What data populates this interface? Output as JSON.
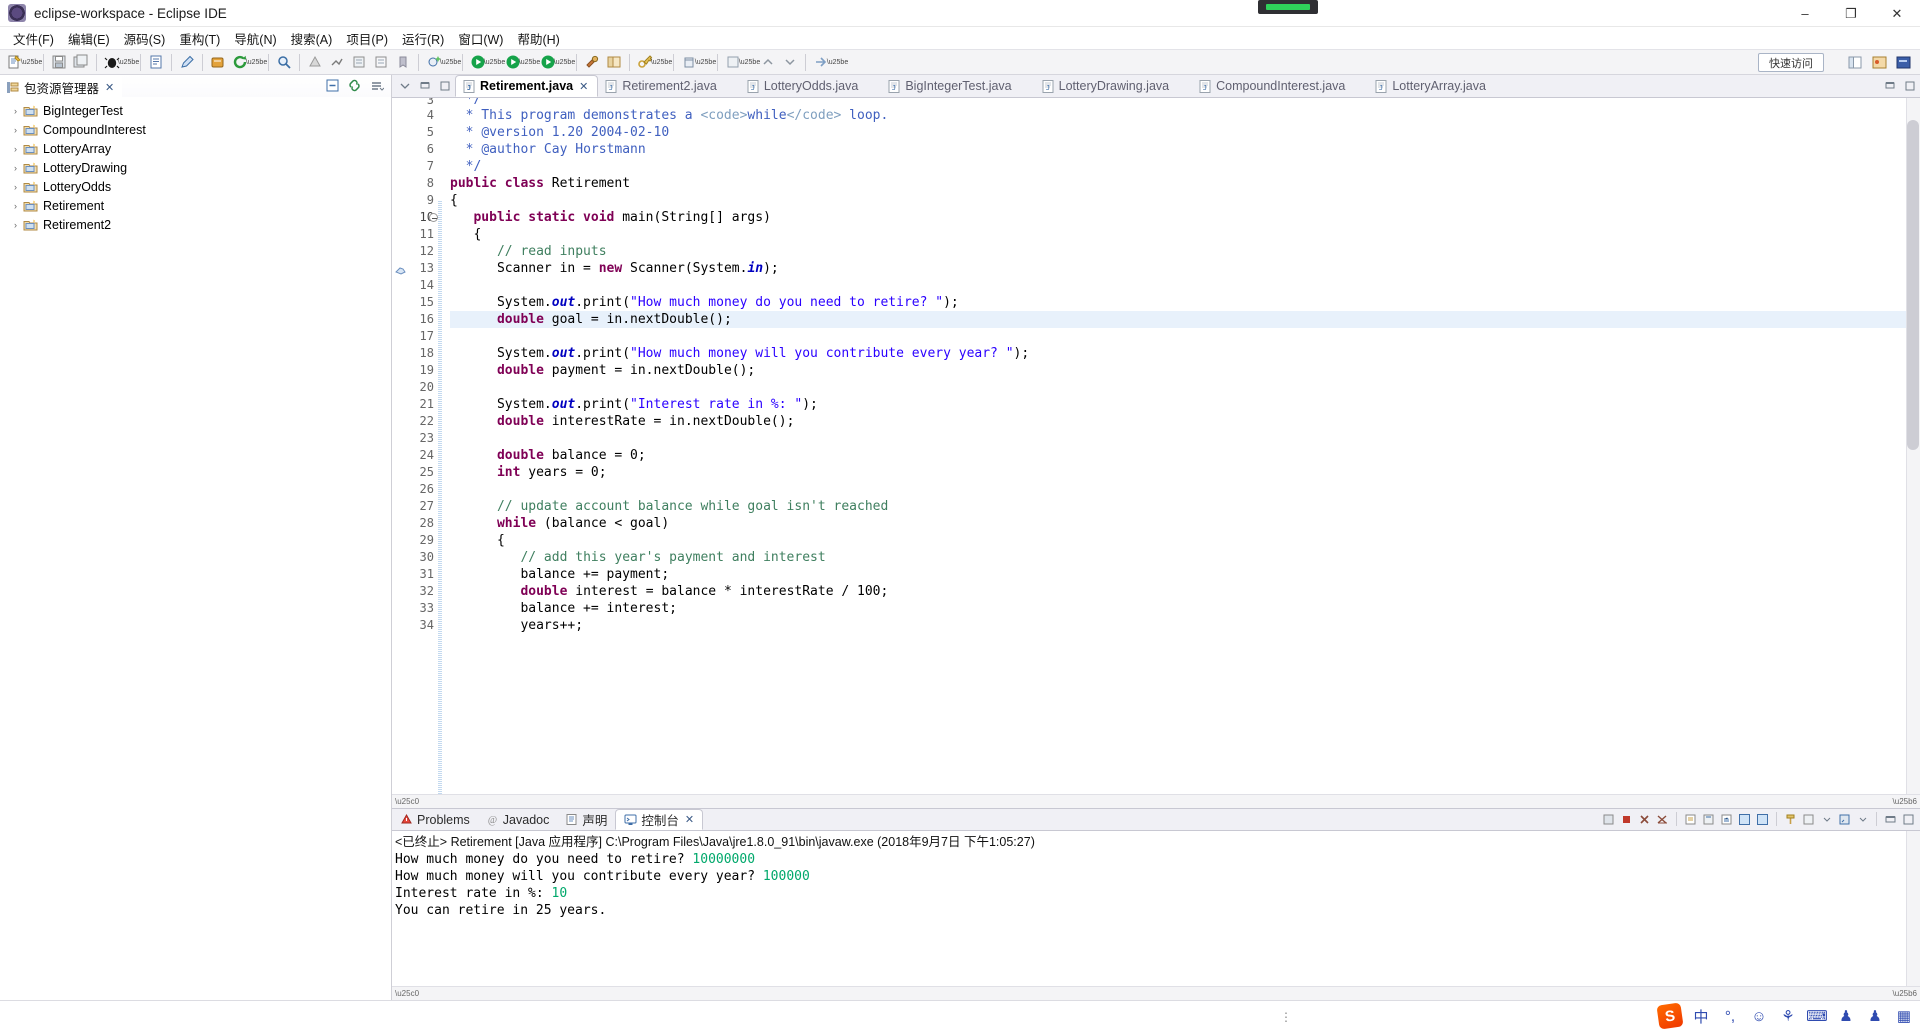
{
  "window": {
    "title": "eclipse-workspace - Eclipse IDE",
    "app_icon": "eclipse-icon",
    "minimize": "–",
    "maximize": "❐",
    "close": "✕"
  },
  "menubar": {
    "items": [
      {
        "label": "文件(F)",
        "name": "menu-file"
      },
      {
        "label": "编辑(E)",
        "name": "menu-edit"
      },
      {
        "label": "源码(S)",
        "name": "menu-source"
      },
      {
        "label": "重构(T)",
        "name": "menu-refactor"
      },
      {
        "label": "导航(N)",
        "name": "menu-navigate"
      },
      {
        "label": "搜索(A)",
        "name": "menu-search"
      },
      {
        "label": "项目(P)",
        "name": "menu-project"
      },
      {
        "label": "运行(R)",
        "name": "menu-run"
      },
      {
        "label": "窗口(W)",
        "name": "menu-window"
      },
      {
        "label": "帮助(H)",
        "name": "menu-help"
      }
    ]
  },
  "toolbar": {
    "quick_access": "快速访问",
    "quick_access_placeholder": "快速访问"
  },
  "sidebar": {
    "view_title": "包资源管理器",
    "close_glyph": "✕",
    "items": [
      {
        "label": "BigIntegerTest"
      },
      {
        "label": "CompoundInterest"
      },
      {
        "label": "LotteryArray"
      },
      {
        "label": "LotteryDrawing"
      },
      {
        "label": "LotteryOdds"
      },
      {
        "label": "Retirement"
      },
      {
        "label": "Retirement2"
      }
    ],
    "expander": "›"
  },
  "editor": {
    "tabs": [
      {
        "label": "Retirement.java",
        "active": true,
        "close": "✕"
      },
      {
        "label": "Retirement2.java",
        "active": false
      },
      {
        "label": "LotteryOdds.java",
        "active": false
      },
      {
        "label": "BigIntegerTest.java",
        "active": false
      },
      {
        "label": "LotteryDrawing.java",
        "active": false
      },
      {
        "label": "CompoundInterest.java",
        "active": false
      },
      {
        "label": "LotteryArray.java",
        "active": false
      }
    ],
    "first_visible_line": 4,
    "highlighted_line": 16,
    "breakpoint_line": 13,
    "fold_marker_line": 10,
    "lines": [
      {
        "n": 4,
        "segments": [
          {
            "t": "  * This program demonstrates a ",
            "c": "jdoc"
          },
          {
            "t": "<code>",
            "c": "jtag"
          },
          {
            "t": "while",
            "c": "jdoc"
          },
          {
            "t": "</code>",
            "c": "jtag"
          },
          {
            "t": " loop.",
            "c": "jdoc"
          }
        ]
      },
      {
        "n": 5,
        "segments": [
          {
            "t": "  * ",
            "c": "jdoc"
          },
          {
            "t": "@version",
            "c": "jdoc"
          },
          {
            "t": " 1.20 2004-02-10",
            "c": "jdoc"
          }
        ]
      },
      {
        "n": 6,
        "segments": [
          {
            "t": "  * ",
            "c": "jdoc"
          },
          {
            "t": "@author",
            "c": "jdoc"
          },
          {
            "t": " Cay Horstmann",
            "c": "jdoc"
          }
        ]
      },
      {
        "n": 7,
        "segments": [
          {
            "t": "  */",
            "c": "jdoc"
          }
        ]
      },
      {
        "n": 8,
        "segments": [
          {
            "t": "public class",
            "c": "kw"
          },
          {
            "t": " Retirement",
            "c": ""
          }
        ]
      },
      {
        "n": 9,
        "segments": [
          {
            "t": "{",
            "c": ""
          }
        ]
      },
      {
        "n": 10,
        "segments": [
          {
            "t": "   ",
            "c": ""
          },
          {
            "t": "public static void",
            "c": "kw"
          },
          {
            "t": " main(String[] args)",
            "c": ""
          }
        ]
      },
      {
        "n": 11,
        "segments": [
          {
            "t": "   {",
            "c": ""
          }
        ]
      },
      {
        "n": 12,
        "segments": [
          {
            "t": "      ",
            "c": ""
          },
          {
            "t": "// read inputs",
            "c": "cmt"
          }
        ]
      },
      {
        "n": 13,
        "segments": [
          {
            "t": "      Scanner in = ",
            "c": ""
          },
          {
            "t": "new",
            "c": "kw"
          },
          {
            "t": " Scanner(System.",
            "c": ""
          },
          {
            "t": "in",
            "c": "fld"
          },
          {
            "t": ");",
            "c": ""
          }
        ]
      },
      {
        "n": 14,
        "segments": [
          {
            "t": "",
            "c": ""
          }
        ]
      },
      {
        "n": 15,
        "segments": [
          {
            "t": "      System.",
            "c": ""
          },
          {
            "t": "out",
            "c": "fld"
          },
          {
            "t": ".print(",
            "c": ""
          },
          {
            "t": "\"How much money do you need to retire? \"",
            "c": "str"
          },
          {
            "t": ");",
            "c": ""
          }
        ]
      },
      {
        "n": 16,
        "segments": [
          {
            "t": "      ",
            "c": ""
          },
          {
            "t": "double",
            "c": "kw"
          },
          {
            "t": " goal = in.nextDouble();",
            "c": ""
          }
        ]
      },
      {
        "n": 17,
        "segments": [
          {
            "t": "",
            "c": ""
          }
        ]
      },
      {
        "n": 18,
        "segments": [
          {
            "t": "      System.",
            "c": ""
          },
          {
            "t": "out",
            "c": "fld"
          },
          {
            "t": ".print(",
            "c": ""
          },
          {
            "t": "\"How much money will you contribute every year? \"",
            "c": "str"
          },
          {
            "t": ");",
            "c": ""
          }
        ]
      },
      {
        "n": 19,
        "segments": [
          {
            "t": "      ",
            "c": ""
          },
          {
            "t": "double",
            "c": "kw"
          },
          {
            "t": " payment = in.nextDouble();",
            "c": ""
          }
        ]
      },
      {
        "n": 20,
        "segments": [
          {
            "t": "",
            "c": ""
          }
        ]
      },
      {
        "n": 21,
        "segments": [
          {
            "t": "      System.",
            "c": ""
          },
          {
            "t": "out",
            "c": "fld"
          },
          {
            "t": ".print(",
            "c": ""
          },
          {
            "t": "\"Interest rate in %: \"",
            "c": "str"
          },
          {
            "t": ");",
            "c": ""
          }
        ]
      },
      {
        "n": 22,
        "segments": [
          {
            "t": "      ",
            "c": ""
          },
          {
            "t": "double",
            "c": "kw"
          },
          {
            "t": " interestRate = in.nextDouble();",
            "c": ""
          }
        ]
      },
      {
        "n": 23,
        "segments": [
          {
            "t": "",
            "c": ""
          }
        ]
      },
      {
        "n": 24,
        "segments": [
          {
            "t": "      ",
            "c": ""
          },
          {
            "t": "double",
            "c": "kw"
          },
          {
            "t": " balance = 0;",
            "c": ""
          }
        ]
      },
      {
        "n": 25,
        "segments": [
          {
            "t": "      ",
            "c": ""
          },
          {
            "t": "int",
            "c": "kw"
          },
          {
            "t": " years = 0;",
            "c": ""
          }
        ]
      },
      {
        "n": 26,
        "segments": [
          {
            "t": "",
            "c": ""
          }
        ]
      },
      {
        "n": 27,
        "segments": [
          {
            "t": "      ",
            "c": ""
          },
          {
            "t": "// update account balance while goal isn't reached",
            "c": "cmt"
          }
        ]
      },
      {
        "n": 28,
        "segments": [
          {
            "t": "      ",
            "c": ""
          },
          {
            "t": "while",
            "c": "kw"
          },
          {
            "t": " (balance < goal)",
            "c": ""
          }
        ]
      },
      {
        "n": 29,
        "segments": [
          {
            "t": "      {",
            "c": ""
          }
        ]
      },
      {
        "n": 30,
        "segments": [
          {
            "t": "         ",
            "c": ""
          },
          {
            "t": "// add this year's payment and interest",
            "c": "cmt"
          }
        ]
      },
      {
        "n": 31,
        "segments": [
          {
            "t": "         balance += payment;",
            "c": ""
          }
        ]
      },
      {
        "n": 32,
        "segments": [
          {
            "t": "         ",
            "c": ""
          },
          {
            "t": "double",
            "c": "kw"
          },
          {
            "t": " interest = balance * interestRate / 100;",
            "c": ""
          }
        ]
      },
      {
        "n": 33,
        "segments": [
          {
            "t": "         balance += interest;",
            "c": ""
          }
        ]
      },
      {
        "n": 34,
        "segments": [
          {
            "t": "         years++;",
            "c": ""
          }
        ]
      }
    ]
  },
  "console_panel": {
    "tabs": [
      {
        "label": "Problems",
        "active": false,
        "icon": "problems-icon"
      },
      {
        "label": "Javadoc",
        "active": false,
        "icon": "javadoc-icon"
      },
      {
        "label": "声明",
        "active": false,
        "icon": "declaration-icon"
      },
      {
        "label": "控制台",
        "active": true,
        "icon": "console-icon",
        "close": "✕"
      }
    ],
    "launch_meta": "<已终止> Retirement [Java 应用程序] C:\\Program Files\\Java\\jre1.8.0_91\\bin\\javaw.exe  (2018年9月7日 下午1:05:27)",
    "output": [
      {
        "prompt": "How much money do you need to retire? ",
        "value": "10000000"
      },
      {
        "prompt": "How much money will you contribute every year? ",
        "value": "100000"
      },
      {
        "prompt": "Interest rate in %: ",
        "value": "10"
      },
      {
        "prompt": "You can retire in 25 years.",
        "value": ""
      }
    ]
  },
  "statusbar": {
    "dots": "⋮",
    "tray": [
      {
        "name": "sogou-ime-logo",
        "glyph": "S"
      },
      {
        "name": "ime-chinese-mode",
        "glyph": "中"
      },
      {
        "name": "ime-punctuation",
        "glyph": "°,"
      },
      {
        "name": "ime-emoji",
        "glyph": "☺"
      },
      {
        "name": "ime-voice-input",
        "glyph": "⚘"
      },
      {
        "name": "ime-soft-keyboard",
        "glyph": "⌨"
      },
      {
        "name": "ime-user",
        "glyph": "♟"
      },
      {
        "name": "ime-skin",
        "glyph": "♟"
      },
      {
        "name": "ime-toolbox",
        "glyph": "▦"
      }
    ]
  },
  "colors": {
    "accent": "#2a00ff",
    "keyword": "#7f0055",
    "comment": "#3f7f5f",
    "javadoc": "#3f5fbf",
    "console_value": "#00a86b",
    "toolbar_bg": "#f4f4f6",
    "highlight_line": "#e8f1fb"
  }
}
